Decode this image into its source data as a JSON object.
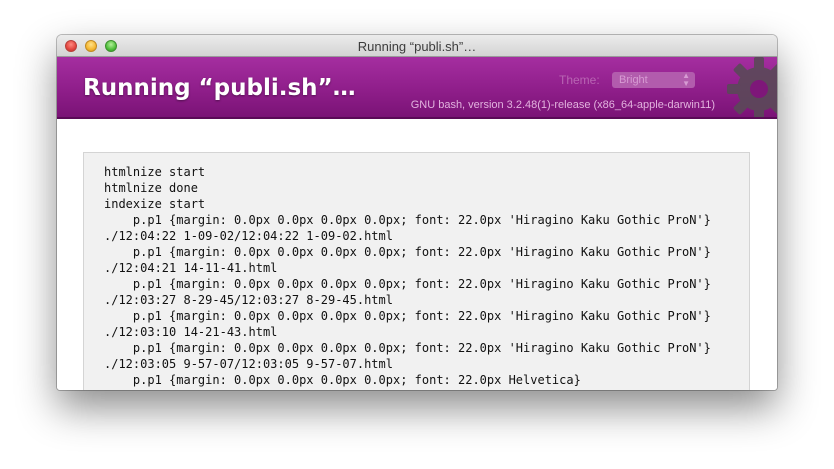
{
  "window": {
    "title": "Running “publi.sh”…"
  },
  "header": {
    "title": "Running “publi.sh”…",
    "theme_label": "Theme:",
    "theme_value": "Bright",
    "version": "GNU bash, version 3.2.48(1)-release (x86_64-apple-darwin11)"
  },
  "output": {
    "lines": [
      "htmlnize start",
      "htmlnize done",
      "indexize start",
      "    p.p1 {margin: 0.0px 0.0px 0.0px 0.0px; font: 22.0px 'Hiragino Kaku Gothic ProN'}",
      "./12:04:22 1-09-02/12:04:22 1-09-02.html",
      "    p.p1 {margin: 0.0px 0.0px 0.0px 0.0px; font: 22.0px 'Hiragino Kaku Gothic ProN'}",
      "./12:04:21 14-11-41.html",
      "    p.p1 {margin: 0.0px 0.0px 0.0px 0.0px; font: 22.0px 'Hiragino Kaku Gothic ProN'}",
      "./12:03:27 8-29-45/12:03:27 8-29-45.html",
      "    p.p1 {margin: 0.0px 0.0px 0.0px 0.0px; font: 22.0px 'Hiragino Kaku Gothic ProN'}",
      "./12:03:10 14-21-43.html",
      "    p.p1 {margin: 0.0px 0.0px 0.0px 0.0px; font: 22.0px 'Hiragino Kaku Gothic ProN'}",
      "./12:03:05 9-57-07/12:03:05 9-57-07.html",
      "    p.p1 {margin: 0.0px 0.0px 0.0px 0.0px; font: 22.0px Helvetica}"
    ]
  },
  "colors": {
    "header_purple": "#8f1e8a",
    "header_purple_light": "#a52ea0",
    "output_bg": "#f1f1f1"
  },
  "icons": {
    "close": "close-button",
    "minimize": "minimize-button",
    "zoom": "zoom-button",
    "decoration": "gear-icon"
  }
}
